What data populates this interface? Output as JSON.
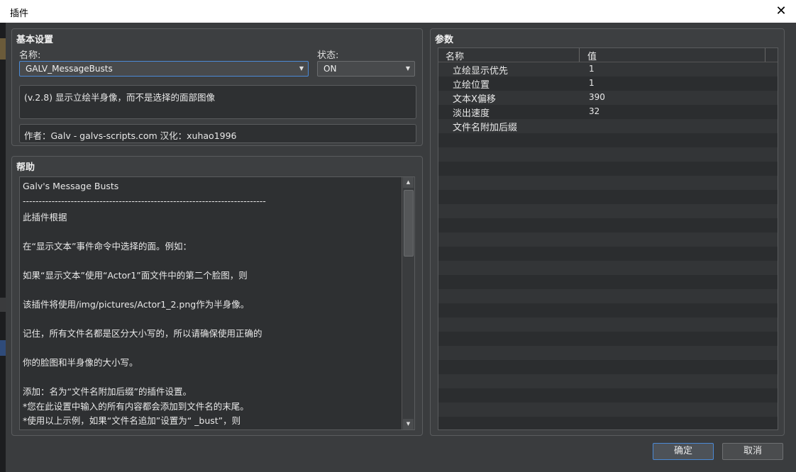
{
  "window": {
    "title": "插件",
    "close_glyph": "✕"
  },
  "basic": {
    "title": "基本设置",
    "name_label": "名称:",
    "name_value": "GALV_MessageBusts",
    "status_label": "状态:",
    "status_value": "ON",
    "description": "(v.2.8) 显示立绘半身像，而不是选择的面部图像",
    "author": "作者：Galv - galvs-scripts.com  汉化：xuhao1996"
  },
  "help": {
    "title": "帮助",
    "lines": [
      "Galv's Message Busts",
      "----------------------------------------------------------------------------",
      "此插件根据",
      "",
      "在“显示文本”事件命令中选择的面。例如：",
      "",
      "如果“显示文本”使用“Actor1”面文件中的第二个脸图，则",
      "",
      "该插件将使用/img/pictures/Actor1_2.png作为半身像。",
      "",
      "记住，所有文件名都是区分大小写的，所以请确保使用正确的",
      "",
      "你的脸图和半身像的大小写。",
      "",
      "添加：名为“文件名附加后缀”的插件设置。",
      " *您在此设置中输入的所有内容都会添加到文件名的末尾。",
      " *使用以上示例，如果“文件名追加”设置为“ _bust”，则"
    ]
  },
  "params": {
    "title": "参数",
    "col_name": "名称",
    "col_value": "值",
    "rows": [
      {
        "name": "立绘显示优先",
        "value": "1"
      },
      {
        "name": "立绘位置",
        "value": "1"
      },
      {
        "name": "文本X偏移",
        "value": "390"
      },
      {
        "name": "淡出速度",
        "value": "32"
      },
      {
        "name": "文件名附加后缀",
        "value": ""
      }
    ]
  },
  "buttons": {
    "ok": "确定",
    "cancel": "取消"
  },
  "icons": {
    "dropdown": "▼",
    "scroll_up": "▲",
    "scroll_down": "▼"
  }
}
